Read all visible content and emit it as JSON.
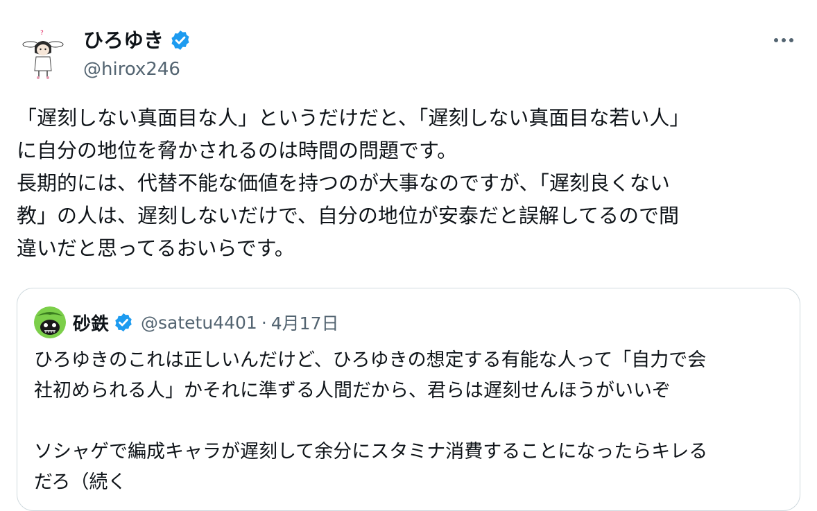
{
  "post": {
    "author": {
      "display_name": "ひろゆき",
      "handle": "@hirox246",
      "verified_icon": "verified-badge-icon",
      "avatar_icon": "avatar-illustration"
    },
    "more_icon": "more-options-icon",
    "text": "「遅刻しない真面目な人」というだけだと、「遅刻しない真面目な若い人」\nに自分の地位を脅かされるのは時間の問題です。\n長期的には、代替不能な価値を持つのが大事なのですが、「遅刻良くない\n教」の人は、遅刻しないだけで、自分の地位が安泰だと誤解してるので間\n違いだと思ってるおいらです。"
  },
  "quoted_post": {
    "author": {
      "display_name": "砂鉄",
      "handle": "@satetu4401",
      "verified_icon": "verified-badge-icon",
      "avatar_icon": "avatar-green-character"
    },
    "separator": "·",
    "date": "4月17日",
    "text": "ひろゆきのこれは正しいんだけど、ひろゆきの想定する有能な人って「自力で会\n社初められる人」かそれに準ずる人間だから、君らは遅刻せんほうがいいぞ\n\nソシャゲで編成キャラが遅刻して余分にスタミナ消費することになったらキレる\nだろ（続く"
  },
  "colors": {
    "text_primary": "#0f1419",
    "text_secondary": "#536471",
    "verified_blue": "#1d9bf0",
    "border": "#cfd9de"
  }
}
